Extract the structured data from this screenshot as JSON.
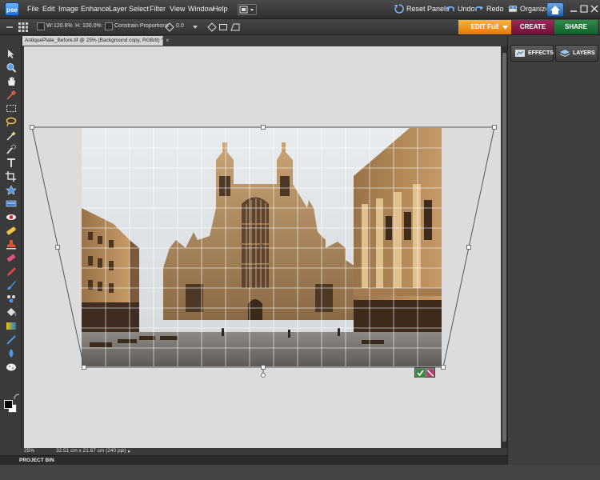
{
  "app": {
    "logo": "pse"
  },
  "menu": [
    "File",
    "Edit",
    "Image",
    "Enhance",
    "Layer",
    "Select",
    "Filter",
    "View",
    "Window",
    "Help"
  ],
  "toolbar_right": {
    "reset_panels": "Reset Panels",
    "undo": "Undo",
    "redo": "Redo",
    "organizer": "Organizer"
  },
  "options": {
    "w_label": "W:",
    "w_value": "120.6%",
    "h_label": "H:",
    "h_value": "100.0%",
    "constrain": "Constrain Proportions",
    "angle_value": "0.0"
  },
  "mode_tabs": {
    "edit": "EDIT Full",
    "create": "CREATE",
    "share": "SHARE"
  },
  "document": {
    "tab_title": "AntiquePlate_Before.tif @ 25% (Background copy, RGB/8) *",
    "close": "×"
  },
  "status": {
    "zoom": "25%",
    "size": "32.51 cm x 21.67 cm (240 ppi)",
    "arrow": "▸"
  },
  "panels": {
    "effects": "EFFECTS",
    "layers": "LAYERS"
  },
  "project_bin": {
    "label": "PROJECT BIN"
  },
  "colors": {
    "edit": "#f08c10",
    "create": "#8c1c4c",
    "share": "#217a3c",
    "canvas": "#dcdcdc"
  },
  "icons": [
    "move-icon",
    "zoom-icon",
    "hand-icon",
    "eyedropper-icon",
    "marquee-icon",
    "lasso-icon",
    "magic-wand-icon",
    "quick-selection-icon",
    "type-icon",
    "crop-icon",
    "cookie-cutter-icon",
    "straighten-icon",
    "red-eye-icon",
    "healing-brush-icon",
    "clone-stamp-icon",
    "eraser-icon",
    "pencil-icon",
    "brush-icon",
    "smart-brush-icon",
    "paint-bucket-icon",
    "gradient-icon",
    "custom-shape-icon",
    "blur-icon",
    "sponge-icon"
  ]
}
